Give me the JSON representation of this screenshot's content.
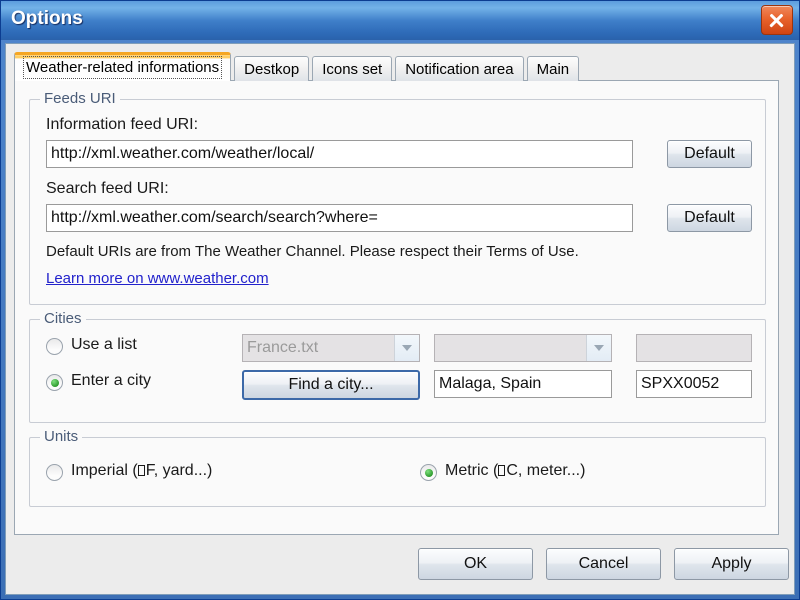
{
  "window": {
    "title": "Options",
    "close_icon": "close-icon",
    "titlebar_color": "#3f7fc9",
    "frame_color": "#4a78bd"
  },
  "tabs": [
    {
      "label": "Weather-related informations",
      "selected": true
    },
    {
      "label": "Destkop",
      "selected": false
    },
    {
      "label": "Icons set",
      "selected": false
    },
    {
      "label": "Notification area",
      "selected": false
    },
    {
      "label": "Main",
      "selected": false
    }
  ],
  "feeds": {
    "group_title": "Feeds URI",
    "info_label": "Information feed URI:",
    "info_value": "http://xml.weather.com/weather/local/",
    "info_default_button": "Default",
    "search_label": "Search feed URI:",
    "search_value": "http://xml.weather.com/search/search?where=",
    "search_default_button": "Default",
    "note": "Default URIs are from The Weather Channel. Please respect their Terms of Use.",
    "link": "Learn more on www.weather.com",
    "link_color": "#2222cc"
  },
  "cities": {
    "group_title": "Cities",
    "use_list_label": "Use a list",
    "use_list_selected": false,
    "list_combo_value": "France.txt",
    "list_combo_disabled": true,
    "city_combo_value": "",
    "city_combo_disabled": true,
    "code_disabled_value": "",
    "enter_city_label": "Enter a city",
    "enter_city_selected": true,
    "find_city_button": "Find a city...",
    "city_value": "Malaga, Spain",
    "city_code_value": "SPXX0052"
  },
  "units": {
    "group_title": "Units",
    "imperial_label_pre": "Imperial (",
    "imperial_label_post": "F, yard...)",
    "imperial_selected": false,
    "metric_label_pre": "Metric (",
    "metric_label_post": "C, meter...)",
    "metric_selected": true
  },
  "footer": {
    "ok": "OK",
    "cancel": "Cancel",
    "apply": "Apply"
  }
}
